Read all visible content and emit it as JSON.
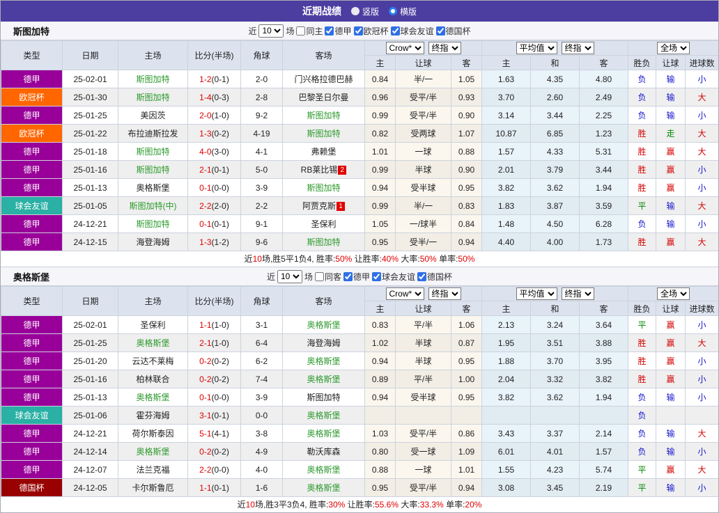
{
  "colors": {
    "title_bar": "#4c3da0",
    "team_highlight": "#2c9a2c",
    "score_red": "#e00000",
    "summary_red": "#e00000",
    "header_bg": "#dce3ef",
    "bottom_line": "#3b3bb0",
    "league": {
      "德甲": "#990099",
      "欧冠杯": "#ff6600",
      "球会友谊": "#2ab0a5",
      "德国杯": "#990000"
    },
    "flags": {
      "胜": "#d40000",
      "平": "#008800",
      "负": "#1414cc",
      "赢": "#d40000",
      "走": "#008800",
      "输": "#1414cc",
      "大": "#d40000",
      "小": "#1414cc"
    }
  },
  "title_bar": {
    "title": "近期战绩",
    "radio_vertical": "竖版",
    "radio_horizontal": "横版",
    "vertical_selected": true,
    "horizontal_selected": false
  },
  "table": {
    "cols": {
      "type": "类型",
      "date": "日期",
      "home": "主场",
      "score": "比分(半场)",
      "corner": "角球",
      "away": "客场"
    },
    "sub_cols": {
      "home": "主",
      "handicap": "让球",
      "away": "客",
      "avg_home": "主",
      "avg_draw": "和",
      "avg_away": "客",
      "result": "胜负",
      "handicap_result": "让球",
      "goals": "进球数"
    },
    "dropdowns": {
      "bookmaker": "Crow*",
      "final_odds": "终指",
      "average": "平均值",
      "final_avg": "终指",
      "scope": "全场"
    }
  },
  "filter_labels": {
    "recent": "近",
    "matches": "场"
  },
  "sections": [
    {
      "team": "斯图加特",
      "filter": {
        "count": "10",
        "same_label": "同主",
        "same_checked": false,
        "leagues": [
          {
            "label": "德甲",
            "checked": true
          },
          {
            "label": "欧冠杯",
            "checked": true
          },
          {
            "label": "球会友谊",
            "checked": true
          },
          {
            "label": "德国杯",
            "checked": true
          }
        ]
      },
      "rows": [
        {
          "league": "德甲",
          "date": "25-02-01",
          "home": "斯图加特",
          "home_highlight": true,
          "score_ft": "1-2",
          "score_ht": "(0-1)",
          "corners": "2-0",
          "away": "门兴格拉德巴赫",
          "away_highlight": false,
          "away_badge": "",
          "odds": [
            "0.84",
            "半/一",
            "1.05",
            "1.63",
            "4.35",
            "4.80"
          ],
          "result": "负",
          "handicap": "输",
          "goals": "小"
        },
        {
          "league": "欧冠杯",
          "date": "25-01-30",
          "home": "斯图加特",
          "home_highlight": true,
          "score_ft": "1-4",
          "score_ht": "(0-3)",
          "corners": "2-8",
          "away": "巴黎圣日尔曼",
          "away_highlight": false,
          "away_badge": "",
          "odds": [
            "0.96",
            "受平/半",
            "0.93",
            "3.70",
            "2.60",
            "2.49"
          ],
          "result": "负",
          "handicap": "输",
          "goals": "大"
        },
        {
          "league": "德甲",
          "date": "25-01-25",
          "home": "美因茨",
          "home_highlight": false,
          "score_ft": "2-0",
          "score_ht": "(1-0)",
          "corners": "9-2",
          "away": "斯图加特",
          "away_highlight": true,
          "away_badge": "",
          "odds": [
            "0.99",
            "受平/半",
            "0.90",
            "3.14",
            "3.44",
            "2.25"
          ],
          "result": "负",
          "handicap": "输",
          "goals": "小"
        },
        {
          "league": "欧冠杯",
          "date": "25-01-22",
          "home": "布拉迪斯拉发",
          "home_highlight": false,
          "score_ft": "1-3",
          "score_ht": "(0-2)",
          "corners": "4-19",
          "away": "斯图加特",
          "away_highlight": true,
          "away_badge": "",
          "odds": [
            "0.82",
            "受两球",
            "1.07",
            "10.87",
            "6.85",
            "1.23"
          ],
          "result": "胜",
          "handicap": "走",
          "goals": "大"
        },
        {
          "league": "德甲",
          "date": "25-01-18",
          "home": "斯图加特",
          "home_highlight": true,
          "score_ft": "4-0",
          "score_ht": "(3-0)",
          "corners": "4-1",
          "away": "弗赖堡",
          "away_highlight": false,
          "away_badge": "",
          "odds": [
            "1.01",
            "一球",
            "0.88",
            "1.57",
            "4.33",
            "5.31"
          ],
          "result": "胜",
          "handicap": "赢",
          "goals": "大"
        },
        {
          "league": "德甲",
          "date": "25-01-16",
          "home": "斯图加特",
          "home_highlight": true,
          "score_ft": "2-1",
          "score_ht": "(0-1)",
          "corners": "5-0",
          "away": "RB莱比锡",
          "away_highlight": false,
          "away_badge": "2",
          "odds": [
            "0.99",
            "半球",
            "0.90",
            "2.01",
            "3.79",
            "3.44"
          ],
          "result": "胜",
          "handicap": "赢",
          "goals": "小"
        },
        {
          "league": "德甲",
          "date": "25-01-13",
          "home": "奥格斯堡",
          "home_highlight": false,
          "score_ft": "0-1",
          "score_ht": "(0-0)",
          "corners": "3-9",
          "away": "斯图加特",
          "away_highlight": true,
          "away_badge": "",
          "odds": [
            "0.94",
            "受半球",
            "0.95",
            "3.82",
            "3.62",
            "1.94"
          ],
          "result": "胜",
          "handicap": "赢",
          "goals": "小"
        },
        {
          "league": "球会友谊",
          "date": "25-01-05",
          "home": "斯图加特(中)",
          "home_highlight": true,
          "score_ft": "2-2",
          "score_ht": "(2-0)",
          "corners": "2-2",
          "away": "阿贾克斯",
          "away_highlight": false,
          "away_badge": "1",
          "odds": [
            "0.99",
            "半/一",
            "0.83",
            "1.83",
            "3.87",
            "3.59"
          ],
          "result": "平",
          "handicap": "输",
          "goals": "大"
        },
        {
          "league": "德甲",
          "date": "24-12-21",
          "home": "斯图加特",
          "home_highlight": true,
          "score_ft": "0-1",
          "score_ht": "(0-1)",
          "corners": "9-1",
          "away": "圣保利",
          "away_highlight": false,
          "away_badge": "",
          "odds": [
            "1.05",
            "一/球半",
            "0.84",
            "1.48",
            "4.50",
            "6.28"
          ],
          "result": "负",
          "handicap": "输",
          "goals": "小"
        },
        {
          "league": "德甲",
          "date": "24-12-15",
          "home": "海登海姆",
          "home_highlight": false,
          "score_ft": "1-3",
          "score_ht": "(1-2)",
          "corners": "9-6",
          "away": "斯图加特",
          "away_highlight": true,
          "away_badge": "",
          "odds": [
            "0.95",
            "受半/一",
            "0.94",
            "4.40",
            "4.00",
            "1.73"
          ],
          "result": "胜",
          "handicap": "赢",
          "goals": "大"
        }
      ],
      "summary": [
        {
          "t": "近"
        },
        {
          "t": "10",
          "red": true
        },
        {
          "t": "场,胜5平1负4, 胜率:"
        },
        {
          "t": "50%",
          "red": true
        },
        {
          "t": " 让胜率:"
        },
        {
          "t": "40%",
          "red": true
        },
        {
          "t": " 大率:"
        },
        {
          "t": "50%",
          "red": true
        },
        {
          "t": " 单率:"
        },
        {
          "t": "50%",
          "red": true
        }
      ]
    },
    {
      "team": "奥格斯堡",
      "filter": {
        "count": "10",
        "same_label": "同客",
        "same_checked": false,
        "leagues": [
          {
            "label": "德甲",
            "checked": true
          },
          {
            "label": "球会友谊",
            "checked": true
          },
          {
            "label": "德国杯",
            "checked": true
          }
        ]
      },
      "rows": [
        {
          "league": "德甲",
          "date": "25-02-01",
          "home": "圣保利",
          "home_highlight": false,
          "score_ft": "1-1",
          "score_ht": "(1-0)",
          "corners": "3-1",
          "away": "奥格斯堡",
          "away_highlight": true,
          "away_badge": "",
          "odds": [
            "0.83",
            "平/半",
            "1.06",
            "2.13",
            "3.24",
            "3.64"
          ],
          "result": "平",
          "handicap": "赢",
          "goals": "小"
        },
        {
          "league": "德甲",
          "date": "25-01-25",
          "home": "奥格斯堡",
          "home_highlight": true,
          "score_ft": "2-1",
          "score_ht": "(1-0)",
          "corners": "6-4",
          "away": "海登海姆",
          "away_highlight": false,
          "away_badge": "",
          "odds": [
            "1.02",
            "半球",
            "0.87",
            "1.95",
            "3.51",
            "3.88"
          ],
          "result": "胜",
          "handicap": "赢",
          "goals": "大"
        },
        {
          "league": "德甲",
          "date": "25-01-20",
          "home": "云达不莱梅",
          "home_highlight": false,
          "score_ft": "0-2",
          "score_ht": "(0-2)",
          "corners": "6-2",
          "away": "奥格斯堡",
          "away_highlight": true,
          "away_badge": "",
          "odds": [
            "0.94",
            "半球",
            "0.95",
            "1.88",
            "3.70",
            "3.95"
          ],
          "result": "胜",
          "handicap": "赢",
          "goals": "小"
        },
        {
          "league": "德甲",
          "date": "25-01-16",
          "home": "柏林联合",
          "home_highlight": false,
          "score_ft": "0-2",
          "score_ht": "(0-2)",
          "corners": "7-4",
          "away": "奥格斯堡",
          "away_highlight": true,
          "away_badge": "",
          "odds": [
            "0.89",
            "平/半",
            "1.00",
            "2.04",
            "3.32",
            "3.82"
          ],
          "result": "胜",
          "handicap": "赢",
          "goals": "小"
        },
        {
          "league": "德甲",
          "date": "25-01-13",
          "home": "奥格斯堡",
          "home_highlight": true,
          "score_ft": "0-1",
          "score_ht": "(0-0)",
          "corners": "3-9",
          "away": "斯图加特",
          "away_highlight": false,
          "away_badge": "",
          "odds": [
            "0.94",
            "受半球",
            "0.95",
            "3.82",
            "3.62",
            "1.94"
          ],
          "result": "负",
          "handicap": "输",
          "goals": "小"
        },
        {
          "league": "球会友谊",
          "date": "25-01-06",
          "home": "霍芬海姆",
          "home_highlight": false,
          "score_ft": "3-1",
          "score_ht": "(0-1)",
          "corners": "0-0",
          "away": "奥格斯堡",
          "away_highlight": true,
          "away_badge": "",
          "odds": [
            "",
            "",
            "",
            "",
            "",
            ""
          ],
          "result": "负",
          "handicap": "",
          "goals": ""
        },
        {
          "league": "德甲",
          "date": "24-12-21",
          "home": "荷尔斯泰因",
          "home_highlight": false,
          "score_ft": "5-1",
          "score_ht": "(4-1)",
          "corners": "3-8",
          "away": "奥格斯堡",
          "away_highlight": true,
          "away_badge": "",
          "odds": [
            "1.03",
            "受平/半",
            "0.86",
            "3.43",
            "3.37",
            "2.14"
          ],
          "result": "负",
          "handicap": "输",
          "goals": "大"
        },
        {
          "league": "德甲",
          "date": "24-12-14",
          "home": "奥格斯堡",
          "home_highlight": true,
          "score_ft": "0-2",
          "score_ht": "(0-2)",
          "corners": "4-9",
          "away": "勒沃库森",
          "away_highlight": false,
          "away_badge": "",
          "odds": [
            "0.80",
            "受一球",
            "1.09",
            "6.01",
            "4.01",
            "1.57"
          ],
          "result": "负",
          "handicap": "输",
          "goals": "小"
        },
        {
          "league": "德甲",
          "date": "24-12-07",
          "home": "法兰克福",
          "home_highlight": false,
          "score_ft": "2-2",
          "score_ht": "(0-0)",
          "corners": "4-0",
          "away": "奥格斯堡",
          "away_highlight": true,
          "away_badge": "",
          "odds": [
            "0.88",
            "一球",
            "1.01",
            "1.55",
            "4.23",
            "5.74"
          ],
          "result": "平",
          "handicap": "赢",
          "goals": "大"
        },
        {
          "league": "德国杯",
          "date": "24-12-05",
          "home": "卡尔斯鲁厄",
          "home_highlight": false,
          "score_ft": "1-1",
          "score_ht": "(0-1)",
          "corners": "1-6",
          "away": "奥格斯堡",
          "away_highlight": true,
          "away_badge": "",
          "odds": [
            "0.95",
            "受平/半",
            "0.94",
            "3.08",
            "3.45",
            "2.19"
          ],
          "result": "平",
          "handicap": "输",
          "goals": "小"
        }
      ],
      "summary": [
        {
          "t": "近"
        },
        {
          "t": "10",
          "red": true
        },
        {
          "t": "场,胜3平3负4, 胜率:"
        },
        {
          "t": "30%",
          "red": true
        },
        {
          "t": " 让胜率:"
        },
        {
          "t": "55.6%",
          "red": true
        },
        {
          "t": " 大率:"
        },
        {
          "t": "33.3%",
          "red": true
        },
        {
          "t": " 单率:"
        },
        {
          "t": "20%",
          "red": true
        }
      ]
    }
  ]
}
